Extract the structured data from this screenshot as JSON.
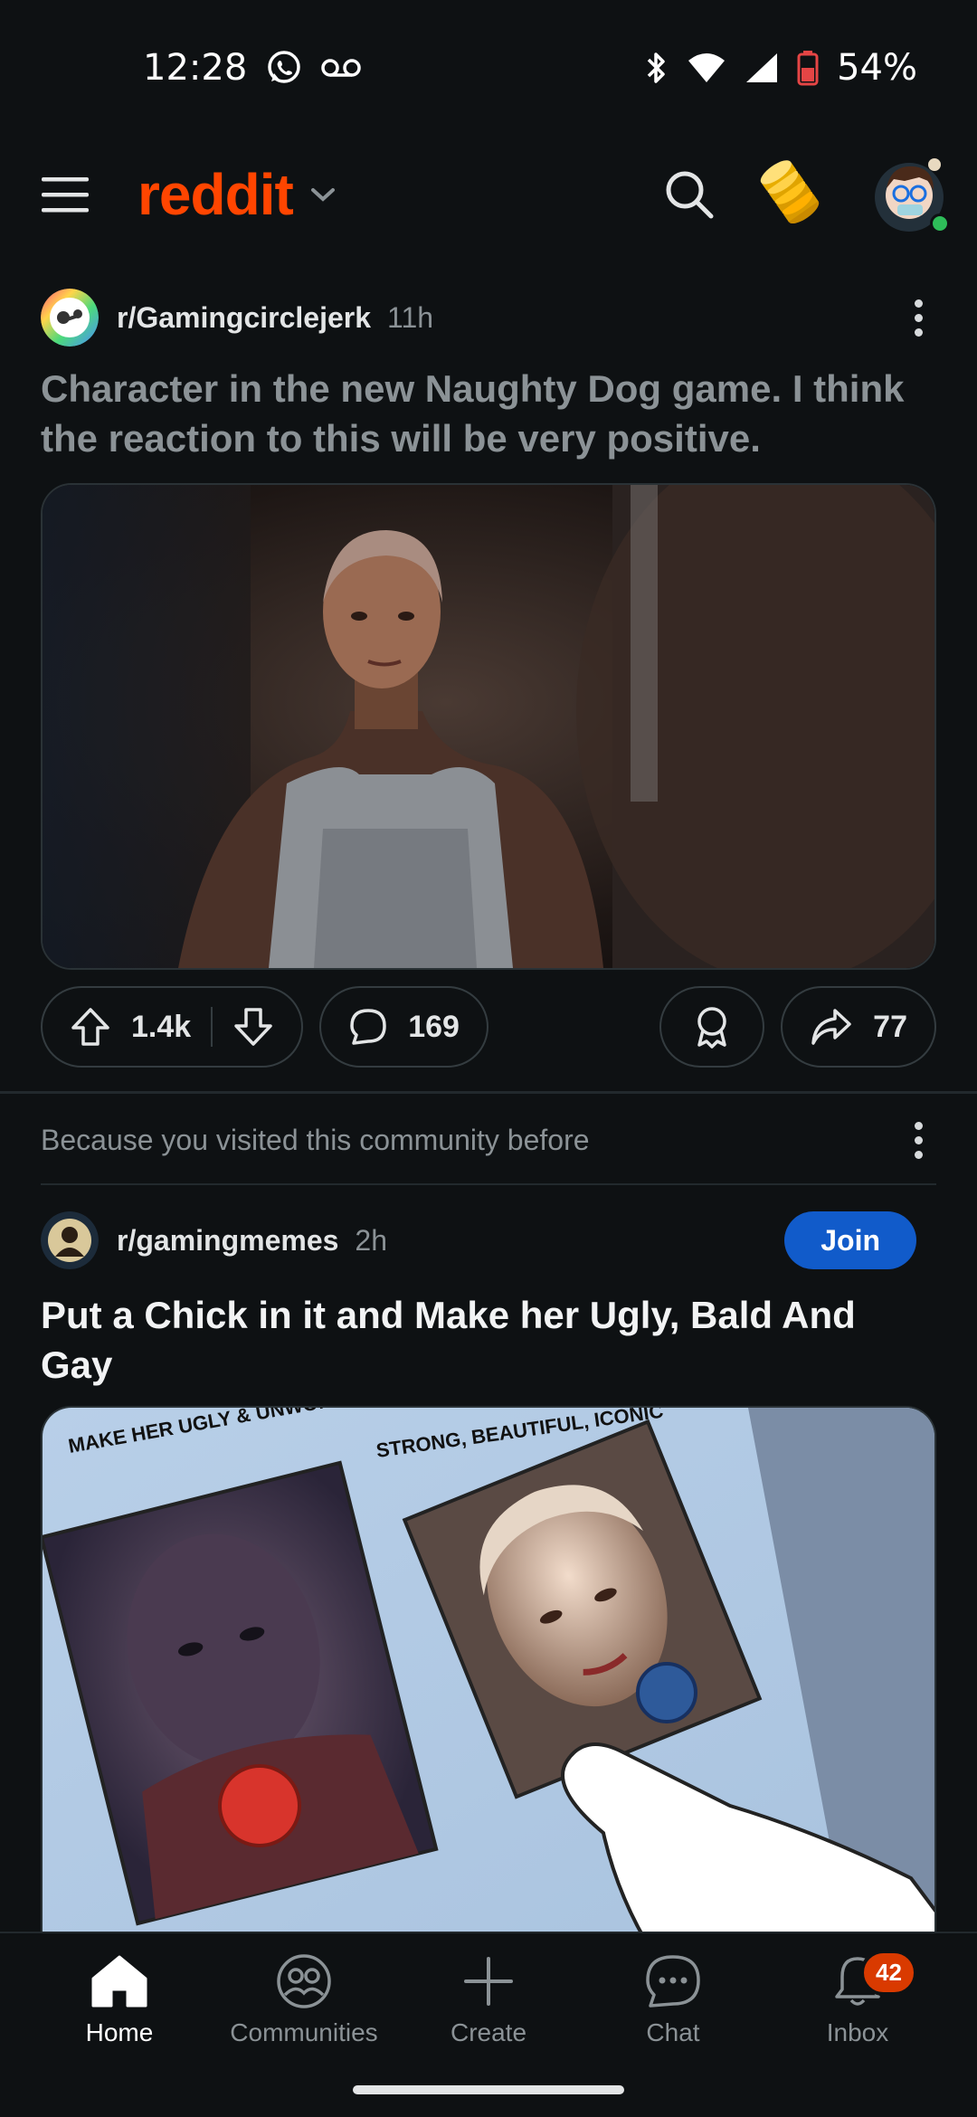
{
  "status_bar": {
    "time": "12:28",
    "battery": "54%"
  },
  "header": {
    "logo": "reddit"
  },
  "post1": {
    "subreddit": "r/Gamingcirclejerk",
    "age": "11h",
    "title": "Character in the new Naughty Dog game. I think the reaction to this will be very positive.",
    "upvotes": "1.4k",
    "comments": "169",
    "shares": "77"
  },
  "recommendation": {
    "reason": "Because you visited this community before"
  },
  "post2": {
    "subreddit": "r/gamingmemes",
    "age": "2h",
    "join_label": "Join",
    "title": "Put a Chick in it and Make her Ugly, Bald And Gay",
    "meme_left_caption": "MAKE HER UGLY & UNWOMAN A WOMAN TO PUSH AN AGENDA",
    "meme_right_caption": "STRONG, BEAUTIFUL, ICONIC"
  },
  "nav": {
    "home": "Home",
    "communities": "Communities",
    "create": "Create",
    "chat": "Chat",
    "inbox": "Inbox",
    "inbox_badge": "42"
  },
  "colors": {
    "accent": "#ff4500",
    "join": "#115bca",
    "background": "#0e1113",
    "badge": "#d93a00"
  }
}
